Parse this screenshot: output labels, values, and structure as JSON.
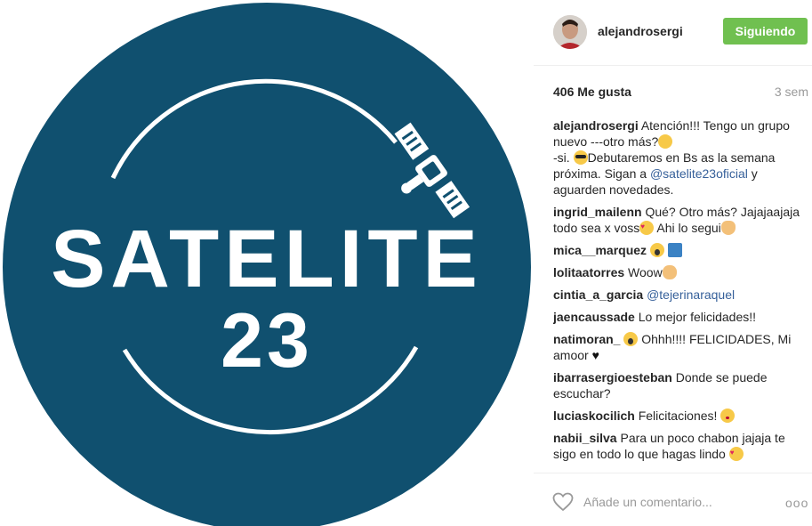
{
  "media": {
    "logo_word": "SATELITE",
    "logo_number": "23",
    "colors": {
      "circle": "#10506f",
      "logo": "#ffffff"
    }
  },
  "header": {
    "username": "alejandrosergi",
    "follow_label": "Siguiendo",
    "colors": {
      "follow_bg": "#70c050"
    }
  },
  "stats": {
    "likes": "406 Me gusta",
    "time": "3 sem"
  },
  "comments": [
    {
      "user": "alejandrosergi",
      "text_a": "Atención!!! Tengo un grupo nuevo ---otro más?",
      "emoji_a": "smiling-face",
      "text_b": "-si.",
      "emoji_b": "sunglasses-face",
      "text_c": "Debutaremos en Bs as la semana próxima. Sigan a",
      "mention": "@satelite23oficial",
      "text_d": "y aguarden novedades."
    },
    {
      "user": "ingrid_mailenn",
      "text_a": "Qué? Otro más? Jajajaajaja todo sea x voss",
      "emoji_a": "heart-eyes-face",
      "text_b": "Ahi lo segui",
      "emoji_b": "pointing-hand"
    },
    {
      "user": "mica__marquez",
      "emoji_a": "screaming-face",
      "emoji_b": "top-arrow"
    },
    {
      "user": "lolitaatorres",
      "text_a": "Woow",
      "emoji_a": "clapping-hands"
    },
    {
      "user": "cintia_a_garcia",
      "mention": "@tejerinaraquel"
    },
    {
      "user": "jaencaussade",
      "text_a": "Lo mejor felicidades!!"
    },
    {
      "user": "natimoran_",
      "emoji_a": "screaming-face",
      "text_a": "Ohhh!!!! FELICIDADES, Mi amoor",
      "emoji_b": "black-heart"
    },
    {
      "user": "ibarrasergioesteban",
      "text_a": "Donde se puede escuchar?"
    },
    {
      "user": "luciaskocilich",
      "text_a": "Felicitaciones!",
      "emoji_a": "kissing-face"
    },
    {
      "user": "nabii_silva",
      "text_a": "Para un poco chabon jajaja te sigo en todo lo que hagas lindo",
      "emoji_a": "heart-eyes-face"
    }
  ],
  "comment_bar": {
    "placeholder": "Añade un comentario...",
    "like_icon": "heart-outline-icon",
    "more_icon": "more-options-icon",
    "more_glyph": "ooo"
  }
}
